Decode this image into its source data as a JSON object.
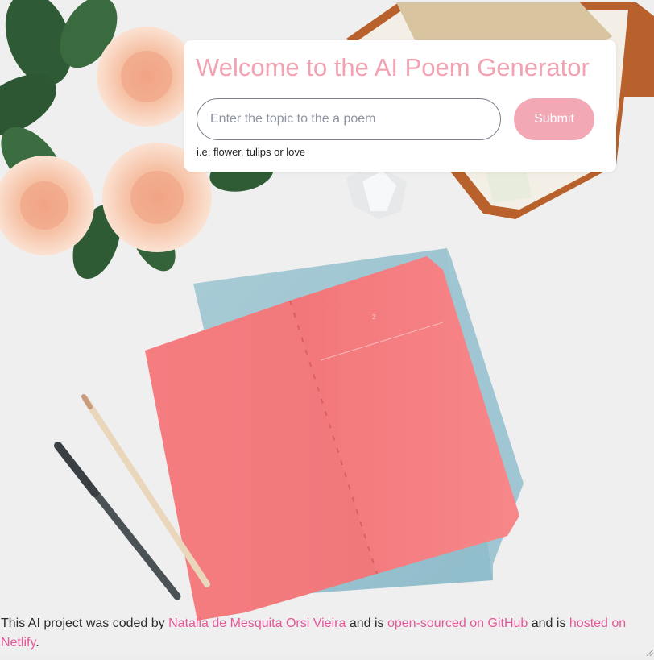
{
  "header": {
    "title": "Welcome to the AI Poem Generator"
  },
  "form": {
    "input_placeholder": "Enter the topic to the a poem",
    "input_value": "",
    "submit_label": "Submit",
    "hint": "i.e: flower, tulips or love"
  },
  "footer": {
    "text_1": "This AI project was coded by",
    "author_link": "Natalia de Mesquita Orsi Vieira",
    "text_2": "and is",
    "github_link": "open-sourced on GitHub",
    "text_3": "and is",
    "netlify_link": "hosted on Netlify",
    "text_end": "."
  },
  "background": {
    "notebook_page_number": "2"
  },
  "colors": {
    "title": "#f2a2b1",
    "submit_background": "#f2a8b5",
    "link": "#e4589a"
  }
}
